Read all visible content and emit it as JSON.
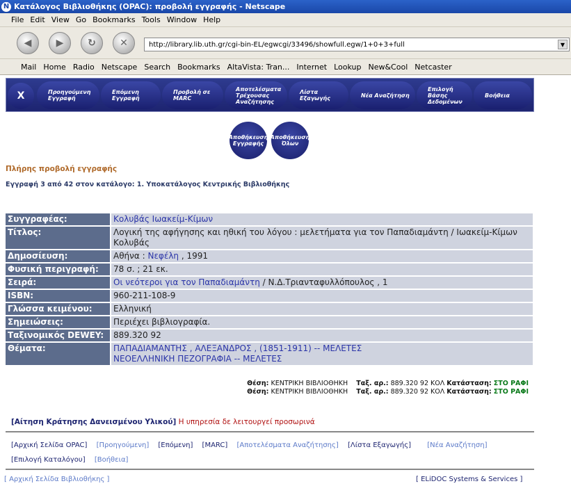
{
  "window": {
    "title": "Κατάλογος Βιβλιοθήκης (OPAC): προβολή εγγραφής - Netscape"
  },
  "menu": [
    "File",
    "Edit",
    "View",
    "Go",
    "Bookmarks",
    "Tools",
    "Window",
    "Help"
  ],
  "url": "http://library.lib.uth.gr/cgi-bin-EL/egwcgi/33496/showfull.egw/1+0+3+full",
  "personal_toolbar": [
    "Mail",
    "Home",
    "Radio",
    "Netscape",
    "Search",
    "Bookmarks",
    "AltaVista: Tran...",
    "Internet",
    "Lookup",
    "New&Cool",
    "Netcaster"
  ],
  "opac_nav": [
    "Προηγούμενη Εγγραφή",
    "Επόμενη Εγγραφή",
    "Προβολή σε MARC",
    "Αποτελέσματα Τρέχουσας Αναζήτησης",
    "Λίστα Εξαγωγής",
    "Νέα Αναζήτηση",
    "Επιλογή Βάσης Δεδομένων",
    "Βοήθεια"
  ],
  "opac_close": "X",
  "save_buttons": [
    "Αποθήκευση Εγγραφής",
    "Αποθήκευση Όλων"
  ],
  "full_view_heading": "Πλήρης προβολή εγγραφής",
  "record_counter": "Εγγραφή 3 από 42 στον κατάλογο: 1. Υποκατάλογος Κεντρικής Βιβλιοθήκης",
  "record": {
    "author_label": "Συγγραφέας:",
    "author": "Κολυβάς Ιωακείμ-Κίμων",
    "title_label": "Τίτλος:",
    "title": "Λογική της αφήγησης και ηθική του λόγου : μελετήματα για τον Παπαδιαμάντη / Ιωακείμ-Κίμων Κολυβάς",
    "pub_label": "Δημοσίευση:",
    "pub_place": "Αθήνα :",
    "publisher": "Νεφέλη",
    "pub_year": ", 1991",
    "phys_label": "Φυσική περιγραφή:",
    "phys": "78 σ. ; 21 εκ.",
    "series_label": "Σειρά:",
    "series_link": "Οι νεότεροι για τον Παπαδιαμάντη",
    "series_rest": " / Ν.Δ.Τριανταφυλλόπουλος , 1",
    "isbn_label": "ISBN:",
    "isbn": "960-211-108-9",
    "lang_label": "Γλώσσα κειμένου:",
    "lang": "Ελληνική",
    "notes_label": "Σημειώσεις:",
    "notes": "Περιέχει βιβλιογραφία.",
    "dewey_label": "Ταξινομικός DEWEY:",
    "dewey": "889.320 92",
    "subjects_label": "Θέματα:",
    "subject1": "ΠΑΠΑΔΙΑΜΑΝΤΗΣ , ΑΛΕΞΑΝΔΡΟΣ , (1851-1911) -- ΜΕΛΕΤΕΣ",
    "subject2": "ΝΕΟΕΛΛΗΝΙΚΗ ΠΕΖΟΓΡΑΦΙΑ -- ΜΕΛΕΤΕΣ"
  },
  "holdings": [
    {
      "loc_label": "Θέση:",
      "loc": "ΚΕΝΤΡΙΚΗ ΒΙΒΛΙΟΘΗΚΗ",
      "call_label": "Ταξ. αρ.:",
      "call": "889.320 92 ΚΟΛ",
      "status_label": "Κατάσταση:",
      "status": "ΣΤΟ ΡΑΦΙ"
    },
    {
      "loc_label": "Θέση:",
      "loc": "ΚΕΝΤΡΙΚΗ ΒΙΒΛΙΟΘΗΚΗ",
      "call_label": "Ταξ. αρ.:",
      "call": "889.320 92 ΚΟΛ",
      "status_label": "Κατάσταση:",
      "status": "ΣΤΟ ΡΑΦΙ"
    }
  ],
  "request": {
    "link": "[Αίτηση Κράτησης Δανεισμένου Υλικού]",
    "note": " Η υπηρεσία δε λειτουργεί προσωρινά"
  },
  "bottom_links": [
    "[Αρχική Σελίδα OPAC]",
    "[Προηγούμενη]",
    "[Επόμενη]",
    "[MARC]",
    "[Αποτελέσματα Αναζήτησης]",
    "[Λίστα Εξαγωγής]",
    "[Νέα Αναζήτηση]",
    "[Επιλογή Καταλόγου]",
    "[Βοήθεια]"
  ],
  "footer": {
    "left": "[ Αρχική Σελίδα Βιβλιοθήκης ]",
    "right": "[ ELiDOC Systems & Services ]"
  },
  "colors": {
    "title_bar": "#1a47a8",
    "field_label_bg": "#5c6c8c",
    "field_value_bg": "#cfd3df",
    "link": "#2b35a8",
    "available": "#0a7a1a",
    "heading": "#b06b2c"
  }
}
